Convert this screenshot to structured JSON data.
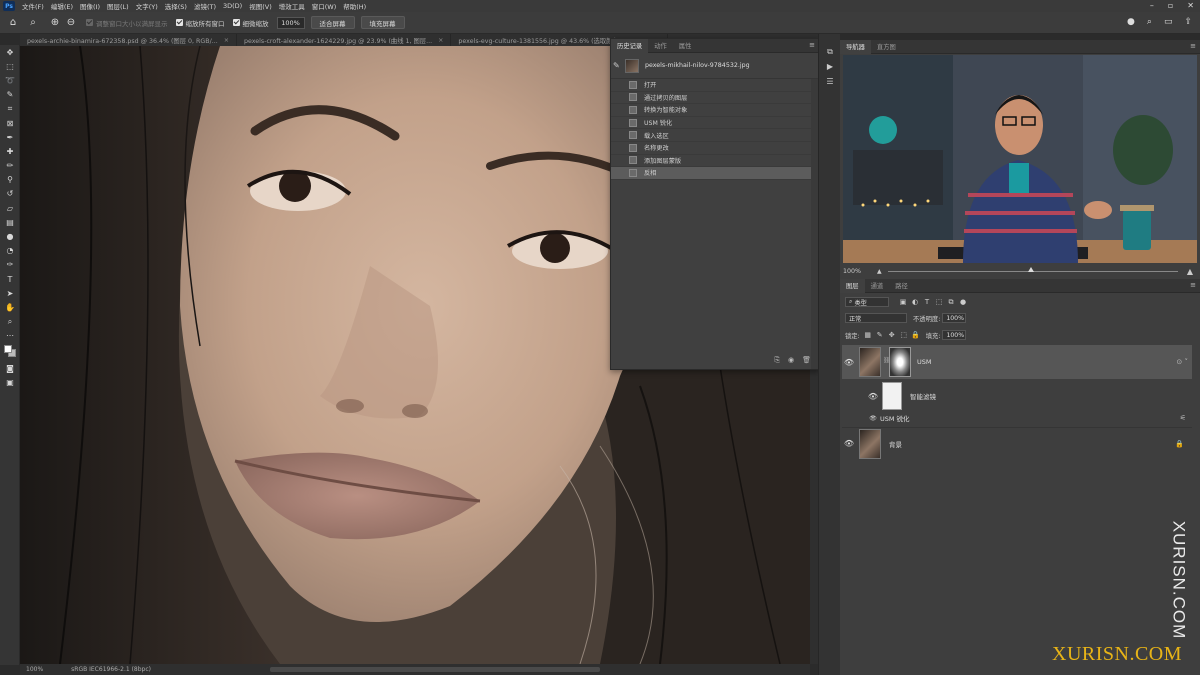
{
  "app": {
    "logo": "Ps"
  },
  "menu": [
    "文件(F)",
    "编辑(E)",
    "图像(I)",
    "图层(L)",
    "文字(Y)",
    "选择(S)",
    "滤镜(T)",
    "3D(D)",
    "视图(V)",
    "增效工具",
    "窗口(W)",
    "帮助(H)"
  ],
  "options": {
    "resize_windows": "调整窗口大小以满屏显示",
    "zoom_all_windows": "缩放所有窗口",
    "scrubby_zoom": "细微缩放",
    "zoom_value": "100%",
    "fit_screen": "适合屏幕",
    "fill_screen": "填充屏幕"
  },
  "doc_tabs": [
    {
      "label": "pexels-archie-binamira-672358.psd @ 36.4% (图层 0, RGB/...",
      "active": false
    },
    {
      "label": "pexels-croft-alexander-1624229.jpg @ 23.9% (曲线 1, 图层...",
      "active": false
    },
    {
      "label": "pexels-evg-culture-1381556.jpg @ 43.6% (选取颜色 1, RGB...",
      "active": false
    }
  ],
  "status": {
    "zoom": "100%",
    "profile": "sRGB IEC61966-2.1 (8bpc)"
  },
  "history_panel": {
    "tabs": [
      "历史记录",
      "动作",
      "属性"
    ],
    "snapshot": "pexels-mikhail-nilov-9784532.jpg",
    "steps": [
      "打开",
      "通过拷贝的图层",
      "转换为智能对象",
      "USM 锐化",
      "载入选区",
      "名称更改",
      "添加图层蒙版",
      "反相"
    ],
    "selected_index": 7
  },
  "navigator_panel": {
    "tabs": [
      "导航器",
      "直方图"
    ],
    "zoom": "100%"
  },
  "layers_panel": {
    "tabs": [
      "图层",
      "通道",
      "路径"
    ],
    "filter_kind": "类型",
    "blend_mode": "正常",
    "opacity_label": "不透明度:",
    "opacity": "100%",
    "lock_label": "锁定:",
    "fill_label": "填充:",
    "fill": "100%",
    "layers": [
      {
        "name": "USM",
        "type": "smart-object-with-mask"
      },
      {
        "name": "智能滤镜",
        "type": "smart-filter-mask"
      },
      {
        "name": "USM 锐化",
        "type": "filter-entry"
      },
      {
        "name": "背景",
        "type": "background",
        "locked": true
      }
    ]
  },
  "watermark": {
    "vertical": "XURISN.COM",
    "horizontal": "XURISN.COM"
  },
  "colors": {
    "accent": "#e8b417",
    "panel": "#3e3e3e",
    "skin": "#c9ab96"
  }
}
